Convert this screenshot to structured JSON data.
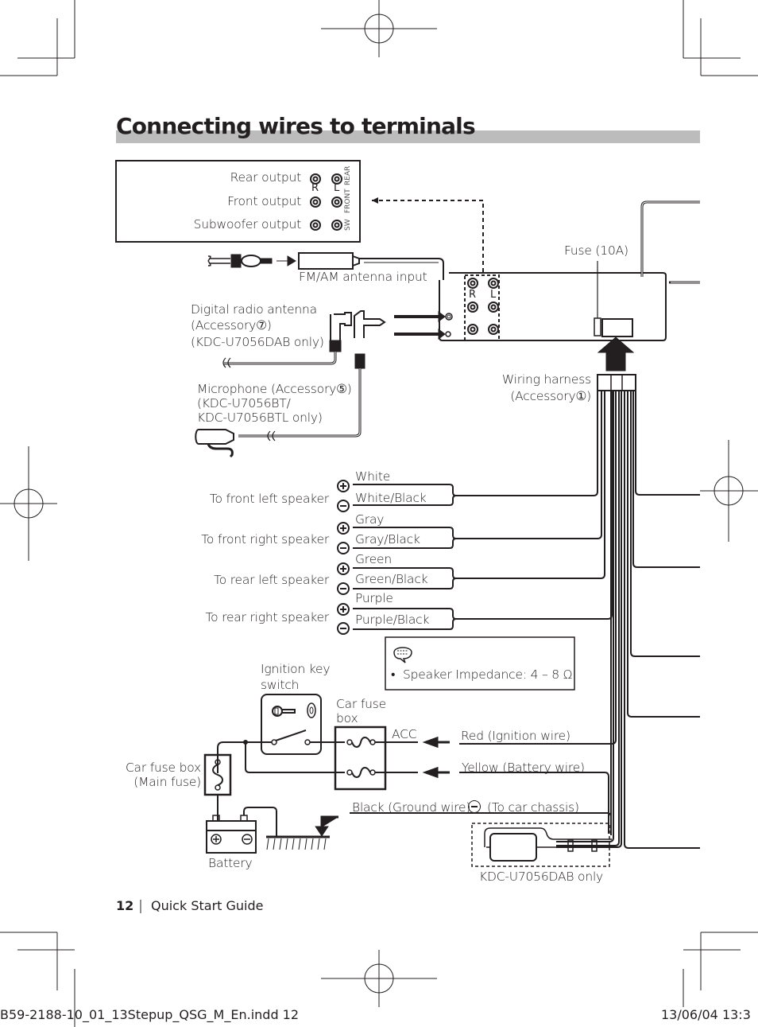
{
  "page": {
    "title": "Connecting wires to terminals",
    "accent_bar_color": "#bcbcbc",
    "footer": {
      "page_number": "12",
      "section": "Quick Start Guide"
    },
    "slug": {
      "file": "B59-2188-10_01_13Stepup_QSG_M_En.indd  12",
      "timestamp": "13/06/04  13:3"
    }
  },
  "outputs_box": {
    "rows": [
      {
        "label": "Rear output",
        "side_tag": "REAR"
      },
      {
        "label": "Front output",
        "side_tag": "FRONT"
      },
      {
        "label": "Subwoofer output",
        "side_tag": "SW"
      }
    ],
    "channel_r": "R",
    "channel_l": "L"
  },
  "head_unit": {
    "antenna_label": "FM/AM antenna input",
    "fuse_label": "Fuse (10A)",
    "channel_r": "R",
    "channel_l": "L",
    "harness_label_1": "Wiring harness",
    "harness_label_2": "(Accessory①)"
  },
  "digital_antenna": {
    "line1": "Digital radio antenna",
    "line2": "(Accessory⑦)",
    "line3": "(KDC-U7056DAB only)"
  },
  "microphone": {
    "line1": "Microphone (Accessory⑤)",
    "line2": "(KDC-U7056BT/",
    "line3": "KDC-U7056BTL only)"
  },
  "speakers": [
    {
      "target": "To front left speaker",
      "plus_wire": "White",
      "minus_wire": "White/Black"
    },
    {
      "target": "To front right speaker",
      "plus_wire": "Gray",
      "minus_wire": "Gray/Black"
    },
    {
      "target": "To rear left speaker",
      "plus_wire": "Green",
      "minus_wire": "Green/Black"
    },
    {
      "target": "To rear right speaker",
      "plus_wire": "Purple",
      "minus_wire": "Purple/Black"
    }
  ],
  "note": {
    "icon": "speech-note-icon",
    "text": "Speaker Impedance: 4 – 8 Ω"
  },
  "power": {
    "ignition_label_1": "Ignition key",
    "ignition_label_2": "switch",
    "car_fuse_box_1": "Car fuse",
    "car_fuse_box_2": "box",
    "acc": "ACC",
    "red_wire": "Red (Ignition wire)",
    "yellow_wire": "Yellow (Battery wire)",
    "main_fuse_1": "Car fuse box",
    "main_fuse_2": "(Main fuse)",
    "ground_wire": "Black (Ground wire)",
    "ground_target": "(To car chassis)",
    "battery": "Battery",
    "dab_only": "KDC-U7056DAB only"
  }
}
